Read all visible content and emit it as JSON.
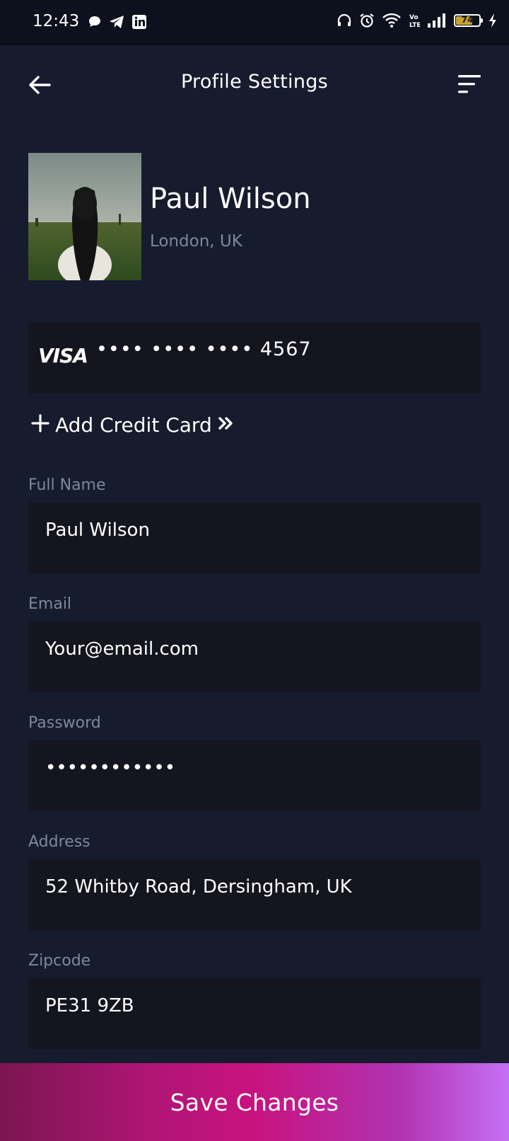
{
  "status_bar": {
    "time": "12:43",
    "battery": "74",
    "left_icons": [
      "chat-bubble-icon",
      "telegram-icon",
      "linkedin-icon"
    ],
    "right_icons": [
      "headphones-icon",
      "alarm-icon",
      "wifi-icon",
      "volte-icon",
      "signal-icon",
      "battery-icon",
      "charging-icon"
    ]
  },
  "header": {
    "title": "Profile Settings",
    "back_icon": "arrow-left-icon",
    "menu_icon": "sort-menu-icon"
  },
  "profile": {
    "name": "Paul Wilson",
    "location": "London, UK"
  },
  "payment": {
    "brand": "VISA",
    "masked_number": "•••• •••• •••• 4567",
    "add_card_label": "Add Credit Card"
  },
  "form": {
    "full_name": {
      "label": "Full Name",
      "value": "Paul Wilson"
    },
    "email": {
      "label": "Email",
      "value": "Your@email.com"
    },
    "password": {
      "label": "Password",
      "value": "••••••••••••"
    },
    "address": {
      "label": "Address",
      "value": "52 Whitby Road, Dersingham, UK"
    },
    "zipcode": {
      "label": "Zipcode",
      "value": "PE31 9ZB"
    }
  },
  "actions": {
    "save_label": "Save Changes"
  },
  "colors": {
    "background": "#161b2e",
    "field_background": "#14151f",
    "label_color": "#7e879d",
    "gradient_start": "#7a1650",
    "gradient_end": "#c470f4"
  }
}
